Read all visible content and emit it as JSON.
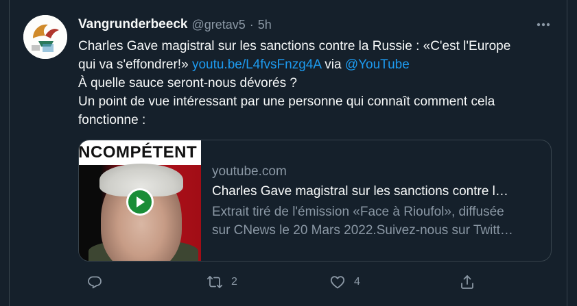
{
  "tweet": {
    "display_name": "Vangrunderbeeck",
    "handle": "@gretav5",
    "separator": "·",
    "time": "5h",
    "text_line1": "Charles Gave magistral sur les sanctions contre la Russie : «C'est l'Europe",
    "text_line2_prefix": "qui va s'effondrer!» ",
    "text_link": "youtu.be/L4fvsFnzg4A",
    "text_via": " via ",
    "text_mention": "@YouTube",
    "text_line3": "À quelle sauce seront-nous dévorés ?",
    "text_line4": "Un point de vue intéressant par une personne qui connaît comment cela",
    "text_line5": "fonctionne :"
  },
  "card": {
    "thumbnail_banner": "INCOMPÉTENT",
    "domain": "youtube.com",
    "title": "Charles Gave magistral sur les sanctions contre l…",
    "description_line1": "Extrait tiré de l'émission «Face à Rioufol», diffusée",
    "description_line2": "sur CNews le 20 Mars 2022.Suivez-nous sur Twitt…"
  },
  "actions": {
    "reply_count": "",
    "retweet_count": "2",
    "like_count": "4"
  },
  "colors": {
    "background": "#15202b",
    "link": "#1d9bf0",
    "secondary_text": "#8b98a5",
    "play_button": "#1a8d37"
  },
  "icons": {
    "avatar": "avatar",
    "more": "more-horizontal-icon",
    "reply": "reply-icon",
    "retweet": "retweet-icon",
    "like": "heart-icon",
    "share": "share-icon",
    "play": "play-icon"
  }
}
